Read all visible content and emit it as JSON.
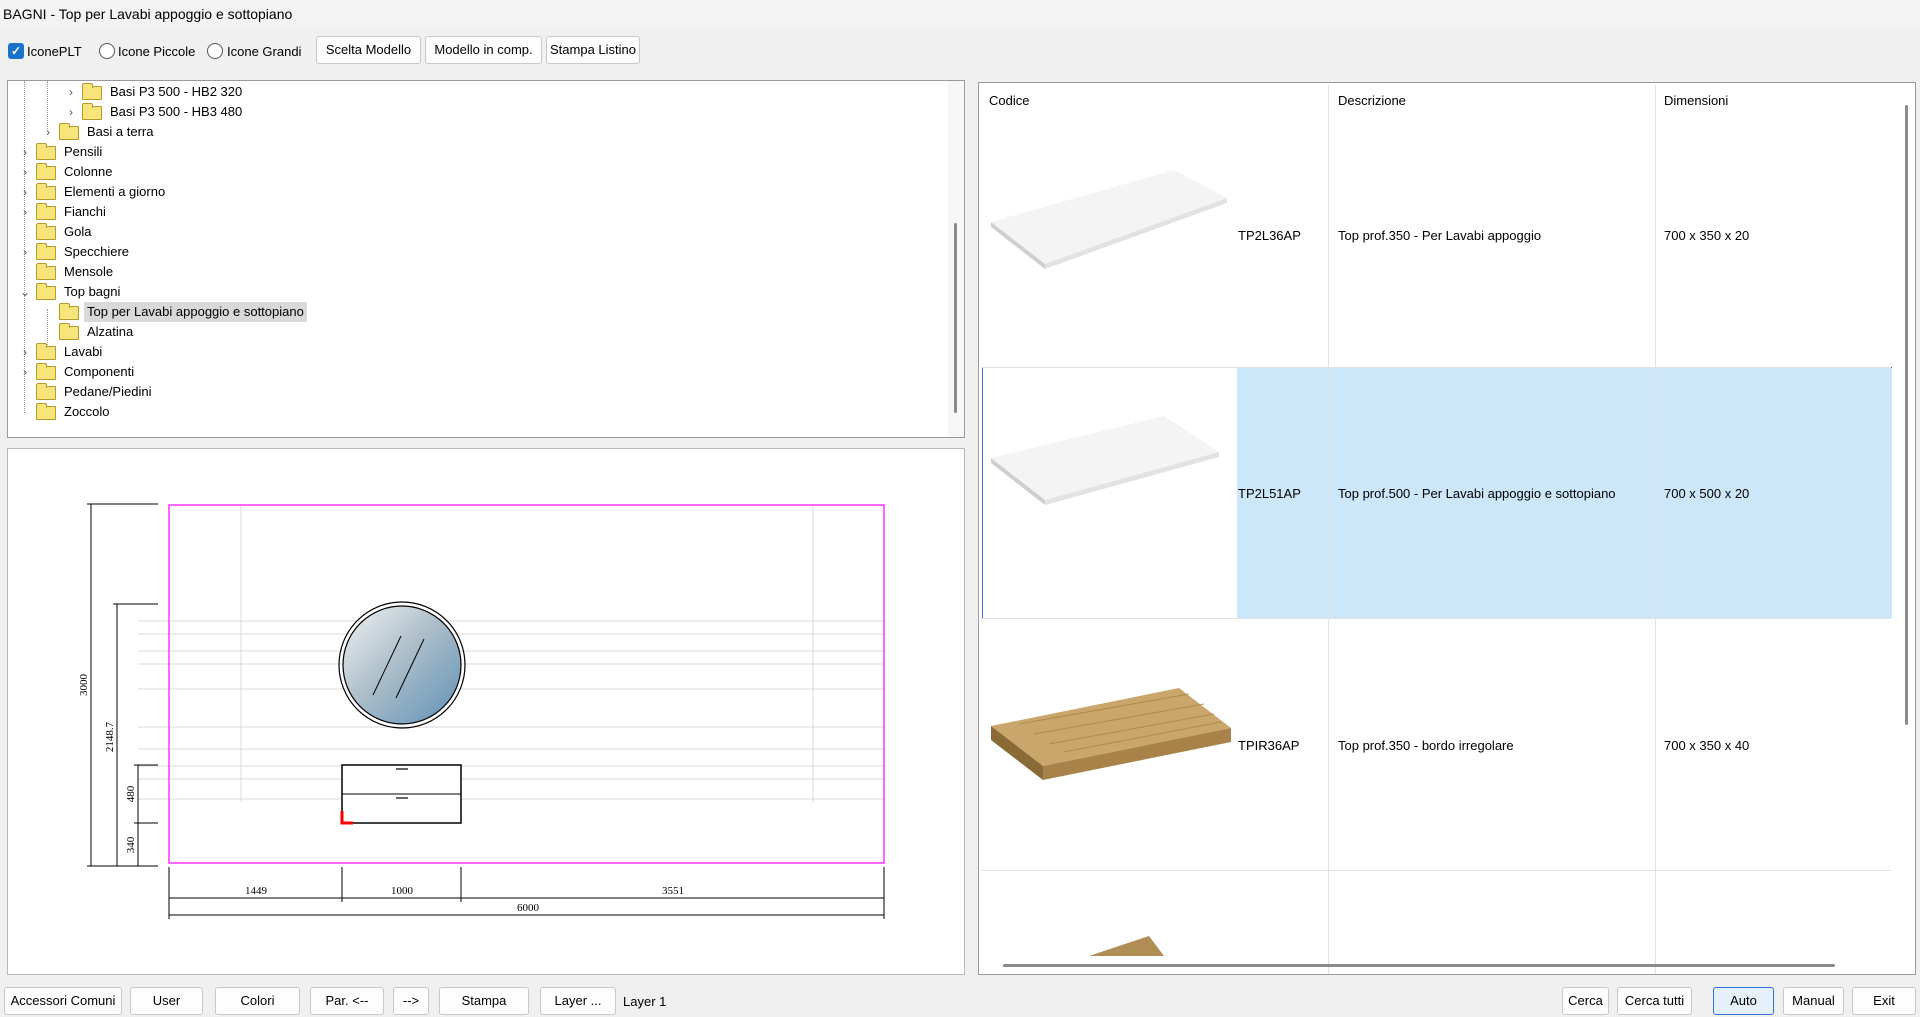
{
  "window": {
    "title": "BAGNI - Top per Lavabi appoggio e sottopiano"
  },
  "toolbar": {
    "icone_plt": "IconePLT",
    "icone_piccole": "Icone Piccole",
    "icone_grandi": "Icone Grandi",
    "scelta_modello": "Scelta Modello",
    "modello_in_comp": "Modello in comp.",
    "stampa_listino": "Stampa Listino"
  },
  "tree": {
    "items": [
      {
        "label": "Basi P3 500 - HB2 320",
        "expander": "›"
      },
      {
        "label": "Basi P3 500 - HB3 480",
        "expander": "›"
      },
      {
        "label": "Basi a terra",
        "expander": "›"
      },
      {
        "label": "Pensili",
        "expander": "›"
      },
      {
        "label": "Colonne",
        "expander": "›"
      },
      {
        "label": "Elementi a giorno",
        "expander": "›"
      },
      {
        "label": "Fianchi",
        "expander": "›"
      },
      {
        "label": "Gola",
        "expander": ""
      },
      {
        "label": "Specchiere",
        "expander": "›"
      },
      {
        "label": "Mensole",
        "expander": ""
      },
      {
        "label": "Top bagni",
        "expander": "⌄"
      },
      {
        "label": "Top per Lavabi appoggio e sottopiano",
        "expander": ""
      },
      {
        "label": "Alzatina",
        "expander": ""
      },
      {
        "label": "Lavabi",
        "expander": "›"
      },
      {
        "label": "Componenti",
        "expander": "›"
      },
      {
        "label": "Pedane/Piedini",
        "expander": ""
      },
      {
        "label": "Zoccolo",
        "expander": ""
      }
    ]
  },
  "drawing": {
    "dims": {
      "height_total": "3000",
      "height_mirror": "2148.7",
      "height_cabinet": "480",
      "height_base": "340",
      "width_left": "1449",
      "width_cabinet": "1000",
      "width_right": "3551",
      "width_total": "6000"
    },
    "colors": {
      "frame": "#ff33ff",
      "marker": "#ff0000"
    }
  },
  "grid": {
    "headers": {
      "codice": "Codice",
      "descrizione": "Descrizione",
      "dimensioni": "Dimensioni"
    },
    "rows": [
      {
        "codice": "TP2L36AP",
        "descrizione": "Top prof.350 - Per Lavabi appoggio",
        "dimensioni": "700 x 350 x 20"
      },
      {
        "codice": "TP2L51AP",
        "descrizione": "Top prof.500 - Per Lavabi appoggio e sottopiano",
        "dimensioni": "700 x 500 x 20"
      },
      {
        "codice": "TPIR36AP",
        "descrizione": "Top prof.350 - bordo irregolare",
        "dimensioni": "700 x 350 x 40"
      }
    ],
    "selection_color": "#cce6fa"
  },
  "bottombar": {
    "accessori_comuni": "Accessori Comuni",
    "user": "User",
    "colori": "Colori",
    "par_prev": "Par. <--",
    "next": "-->",
    "stampa": "Stampa",
    "layer": "Layer ...",
    "layer_status": "Layer 1",
    "cerca": "Cerca",
    "cerca_tutti": "Cerca tutti",
    "auto": "Auto",
    "manual": "Manual",
    "exit": "Exit"
  }
}
